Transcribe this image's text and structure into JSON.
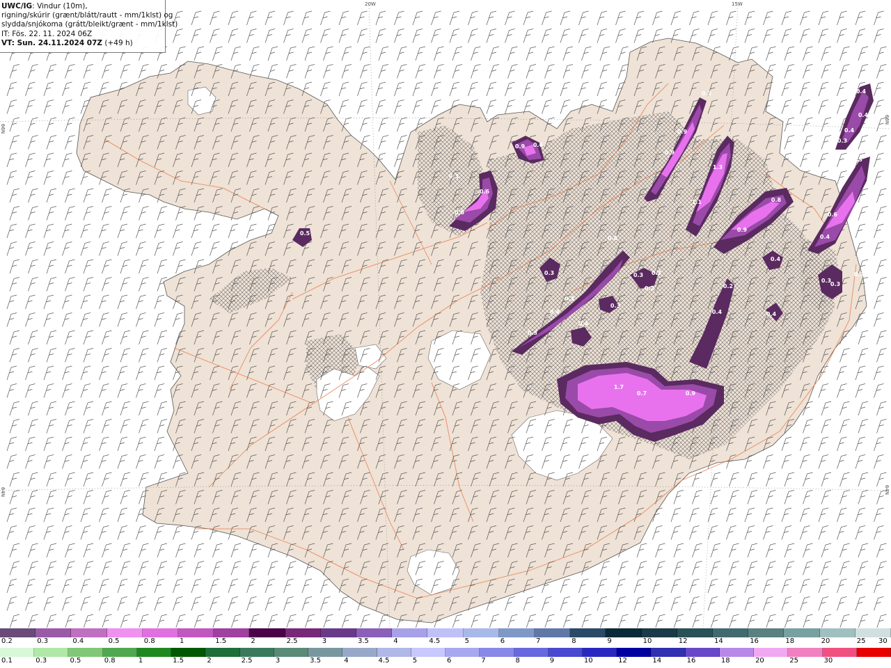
{
  "header": {
    "title": "UWC/IG",
    "title_rest": ": Vindur (10m),",
    "line2": "rigning/skúrir (grænt/blátt/rautt - mm/1klst) og",
    "line3": "slydda/snjókoma (grátt/bleikt/grænt - mm/1klst)",
    "line4": "IT: Fös. 22. 11. 2024 06Z",
    "line5_label": "VT: Sun. 24.11.2024 07Z",
    "line5_rest": " (+49 h)"
  },
  "grid_labels": {
    "lon_20w": "20W",
    "lon_15w": "15W",
    "lat_66n_left": "66N",
    "lat_66n_right": "66N",
    "lat_64n_left": "64N",
    "lat_64n_right": "64N"
  },
  "colors": {
    "land": "#efe2d6",
    "sea": "#ffffff",
    "roads": "#e8703a",
    "snow_dark": "#5a2a60",
    "snow_mid": "#9a4aa8",
    "snow_light": "#e872ee"
  },
  "precip_labels": [
    {
      "text": "0.3"
    },
    {
      "text": "0.4"
    },
    {
      "text": "0.4"
    },
    {
      "text": "0.4"
    },
    {
      "text": "0.3"
    },
    {
      "text": "0.3"
    },
    {
      "text": "0.9"
    },
    {
      "text": "0.9"
    },
    {
      "text": "1.3"
    },
    {
      "text": "1.1"
    },
    {
      "text": "0.8"
    },
    {
      "text": "0.9"
    },
    {
      "text": "0.6"
    },
    {
      "text": "0.9"
    },
    {
      "text": "0.6"
    },
    {
      "text": "0.6"
    },
    {
      "text": "0.6"
    },
    {
      "text": "0.3"
    },
    {
      "text": "0.5"
    },
    {
      "text": "0.4"
    },
    {
      "text": "0.3"
    },
    {
      "text": "0.4"
    },
    {
      "text": "0.4"
    },
    {
      "text": "0.3"
    },
    {
      "text": "0.3"
    },
    {
      "text": "0.3"
    },
    {
      "text": "0.3"
    },
    {
      "text": "0.2"
    },
    {
      "text": "0.3"
    },
    {
      "text": "0.3"
    },
    {
      "text": "0.2"
    },
    {
      "text": "0.4"
    },
    {
      "text": "0.4"
    },
    {
      "text": "0.3"
    },
    {
      "text": "0.4"
    },
    {
      "text": "0.4"
    },
    {
      "text": "0.3"
    },
    {
      "text": "1.7"
    },
    {
      "text": "0.7"
    },
    {
      "text": "0.9"
    }
  ],
  "legend_snow": {
    "labels": [
      "0.2",
      "0.3",
      "0.4",
      "0.5",
      "0.8",
      "1",
      "1.5",
      "2",
      "2.5",
      "3",
      "3.5",
      "4",
      "4.5",
      "5",
      "6",
      "7",
      "8",
      "9",
      "10",
      "12",
      "14",
      "16",
      "18",
      "20",
      "25",
      "30"
    ],
    "colors": [
      "#6a4a78",
      "#9a5aa8",
      "#c070c0",
      "#f090f0",
      "#e070e0",
      "#c058c0",
      "#a040a0",
      "#4a0048",
      "#782878",
      "#6a3a8a",
      "#8a60b8",
      "#a8a0e8",
      "#c0c0f8",
      "#a8b8e8",
      "#8098c8",
      "#6078a8",
      "#2a4a68",
      "#0a2a3a",
      "#1a3a48",
      "#2a5058",
      "#406a70",
      "#5a8080",
      "#78a0a0",
      "#a0c0c0",
      "#d0e0e0"
    ]
  },
  "legend_rain": {
    "labels": [
      "0.1",
      "0.3",
      "0.5",
      "0.8",
      "1",
      "1.5",
      "2",
      "2.5",
      "3",
      "3.5",
      "4",
      "4.5",
      "5",
      "6",
      "7",
      "8",
      "9",
      "10",
      "12",
      "14",
      "16",
      "18",
      "20",
      "25",
      "30"
    ],
    "colors": [
      "#d8f8d8",
      "#b0e8a8",
      "#80c878",
      "#50a850",
      "#208820",
      "#005800",
      "#1e6e3a",
      "#3a7a5a",
      "#5a8a78",
      "#7898a0",
      "#98a8c8",
      "#b0b8e8",
      "#c8c8ff",
      "#a8a8f0",
      "#8888e8",
      "#6868e0",
      "#4848d0",
      "#2828c0",
      "#0000a0",
      "#3030b0",
      "#6848c8",
      "#b888e8",
      "#f0a8f0",
      "#f080c0",
      "#f05080",
      "#e80000"
    ]
  }
}
